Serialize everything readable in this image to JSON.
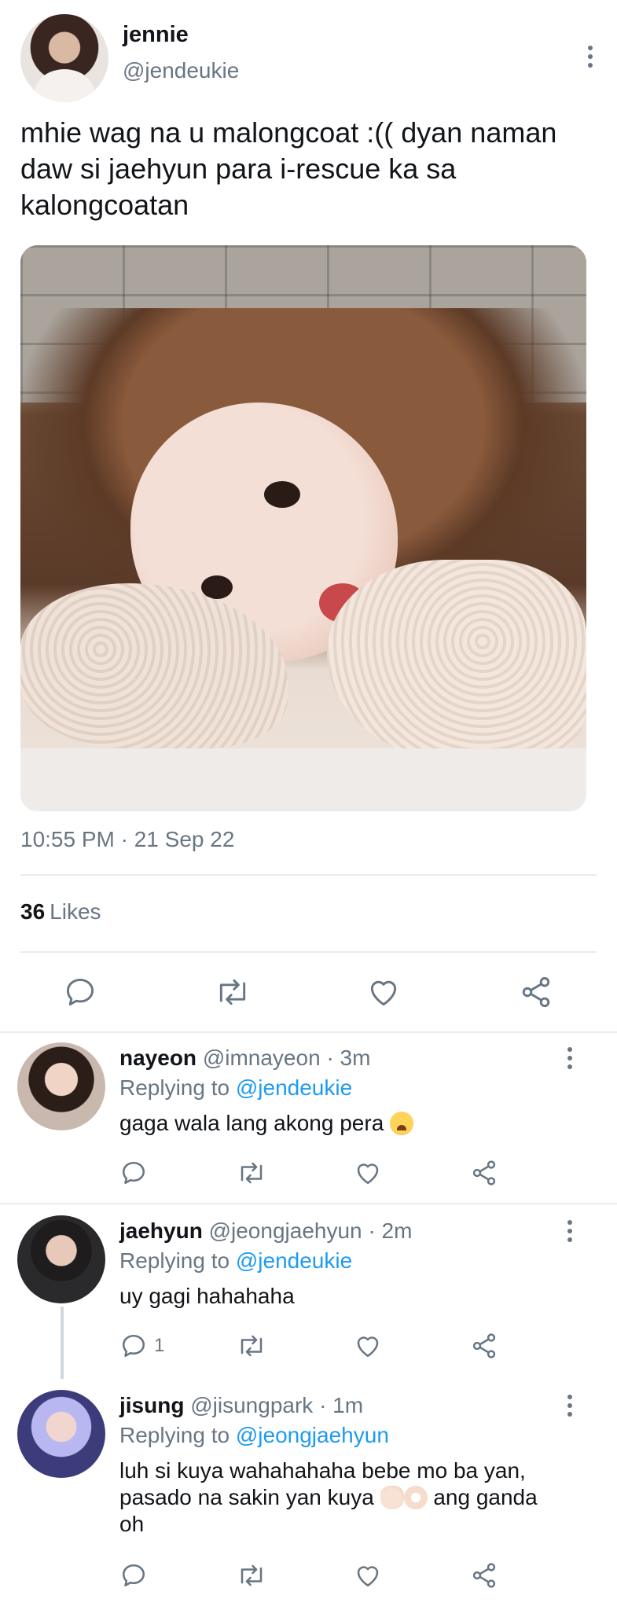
{
  "main_tweet": {
    "name": "jennie",
    "handle": "@jendeukie",
    "text": "mhie wag na u malongcoat :(( dyan naman daw si jaehyun para i-rescue ka sa kalongcoatan",
    "timestamp": "10:55 PM · 21 Sep 22",
    "likes_count": "36",
    "likes_label": "Likes",
    "image_alt": "photo of person resting head on fluffy sleeves"
  },
  "replies": [
    {
      "name": "nayeon",
      "handle": "@imnayeon",
      "time": "· 3m",
      "replying_prefix": "Replying to",
      "replying_to": "@jendeukie",
      "text": "gaga wala lang akong pera",
      "reply_count": ""
    },
    {
      "name": "jaehyun",
      "handle": "@jeongjaehyun",
      "time": "· 2m",
      "replying_prefix": "Replying to",
      "replying_to": "@jendeukie",
      "text": "uy gagi hahahaha",
      "reply_count": "1"
    },
    {
      "name": "jisung",
      "handle": "@jisungpark",
      "time": "· 1m",
      "replying_prefix": "Replying to",
      "replying_to": "@jeongjaehyun",
      "text_line1": "luh si kuya wahahahaha bebe mo ba yan,",
      "text_line2_a": "pasado na sakin yan kuya",
      "text_line2_b": "ang ganda",
      "text_line3": "oh",
      "reply_count": ""
    }
  ],
  "icons": [
    "reply-icon",
    "retweet-icon",
    "like-icon",
    "share-icon",
    "more-icon"
  ],
  "colors": {
    "text_primary": "#111418",
    "text_secondary": "#687684",
    "link": "#1d9bf0",
    "divider": "#e6ecf0"
  }
}
